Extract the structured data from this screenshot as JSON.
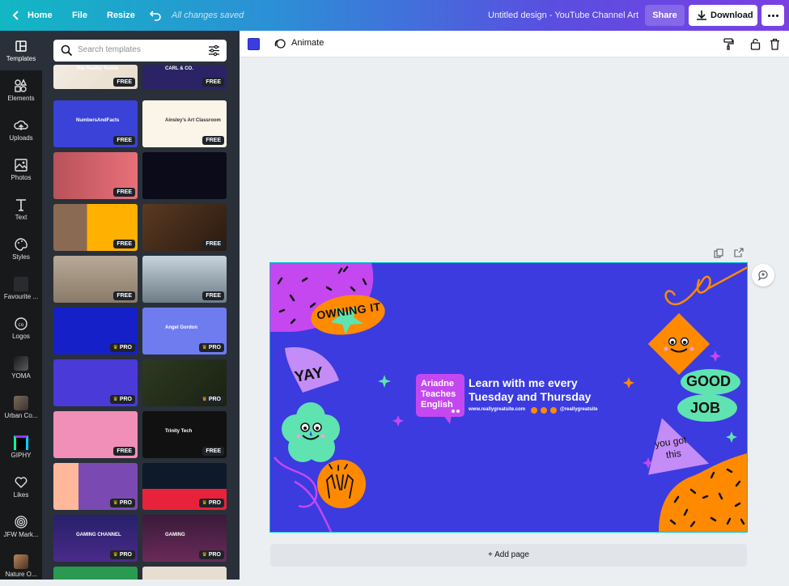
{
  "topbar": {
    "home": "Home",
    "file": "File",
    "resize": "Resize",
    "saved": "All changes saved",
    "title": "Untitled design - YouTube Channel Art",
    "share": "Share",
    "download": "Download"
  },
  "rail": [
    {
      "label": "Templates"
    },
    {
      "label": "Elements"
    },
    {
      "label": "Uploads"
    },
    {
      "label": "Photos"
    },
    {
      "label": "Text"
    },
    {
      "label": "Styles"
    },
    {
      "label": "Favourite ..."
    },
    {
      "label": "Logos"
    },
    {
      "label": "YOMA"
    },
    {
      "label": "Urban Co..."
    },
    {
      "label": "GIPHY"
    },
    {
      "label": "Likes"
    },
    {
      "label": "JFW Mark..."
    },
    {
      "label": "Nature O..."
    }
  ],
  "search": {
    "placeholder": "Search templates"
  },
  "templates": [
    {
      "badge": "FREE",
      "text": "The Reality Textile"
    },
    {
      "badge": "FREE",
      "text": "CARL & CO."
    },
    {
      "badge": "FREE",
      "text": "NumbersAndFacts"
    },
    {
      "badge": "FREE",
      "text": "Ainsley's Art Classroom"
    },
    {
      "badge": "FREE",
      "text": ""
    },
    {
      "badge": "",
      "text": ""
    },
    {
      "badge": "FREE",
      "text": ""
    },
    {
      "badge": "FREE",
      "text": ""
    },
    {
      "badge": "FREE",
      "text": ""
    },
    {
      "badge": "FREE",
      "text": ""
    },
    {
      "badge": "PRO",
      "text": ""
    },
    {
      "badge": "PRO",
      "text": "Angel Gordon"
    },
    {
      "badge": "PRO",
      "text": ""
    },
    {
      "badge": "PRO",
      "text": ""
    },
    {
      "badge": "FREE",
      "text": ""
    },
    {
      "badge": "FREE",
      "text": "Trinity Tech"
    },
    {
      "badge": "PRO",
      "text": ""
    },
    {
      "badge": "PRO",
      "text": ""
    },
    {
      "badge": "PRO",
      "text": "GAMING CHANNEL"
    },
    {
      "badge": "PRO",
      "text": "GAMING"
    }
  ],
  "toolbar": {
    "animate": "Animate",
    "color": "#3c3ce3"
  },
  "canvas": {
    "owning": "OWNING IT",
    "yay": "YAY",
    "good": "GOOD",
    "job": "JOB",
    "yougot1": "you got",
    "yougot2": "this",
    "name1": "Ariadne",
    "name2": "Teaches",
    "name3": "English",
    "headline1": "Learn with me every",
    "headline2": "Tuesday and Thursday",
    "website": "www.reallygreatsite.com",
    "handle": "@reallygreatsite"
  },
  "add_page": "+ Add page"
}
